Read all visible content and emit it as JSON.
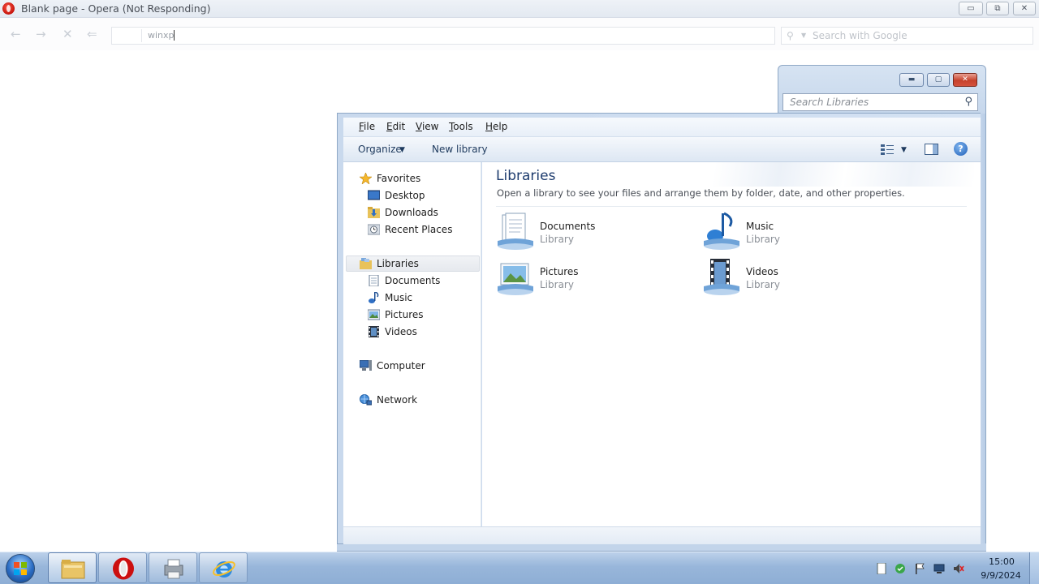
{
  "opera": {
    "title": "Blank page - Opera (Not Responding)",
    "address_value": "winxp",
    "search_placeholder": "Search with Google",
    "caption_minimize": "▭",
    "caption_maximize": "⧉",
    "caption_close": "✕"
  },
  "explorer": {
    "search_placeholder": "Search Libraries",
    "menu": [
      "File",
      "Edit",
      "View",
      "Tools",
      "Help"
    ],
    "commands": {
      "organize": "Organize",
      "new_library": "New library",
      "help": "?"
    },
    "nav": {
      "favorites": "Favorites",
      "favorites_items": [
        "Desktop",
        "Downloads",
        "Recent Places"
      ],
      "libraries": "Libraries",
      "libraries_items": [
        "Documents",
        "Music",
        "Pictures",
        "Videos"
      ],
      "computer": "Computer",
      "network": "Network"
    },
    "content": {
      "title": "Libraries",
      "description": "Open a library to see your files and arrange them by folder, date, and other properties.",
      "items": [
        {
          "name": "Documents",
          "kind": "Library",
          "icon": "documents-library-icon"
        },
        {
          "name": "Music",
          "kind": "Library",
          "icon": "music-library-icon"
        },
        {
          "name": "Pictures",
          "kind": "Library",
          "icon": "pictures-library-icon"
        },
        {
          "name": "Videos",
          "kind": "Library",
          "icon": "videos-library-icon"
        }
      ]
    }
  },
  "taskbar": {
    "time": "15:00",
    "date": "9/9/2024"
  },
  "colors": {
    "title_text": "#1e3c6e",
    "taskbar": "#98b6da",
    "opera_red": "#c4110a"
  }
}
